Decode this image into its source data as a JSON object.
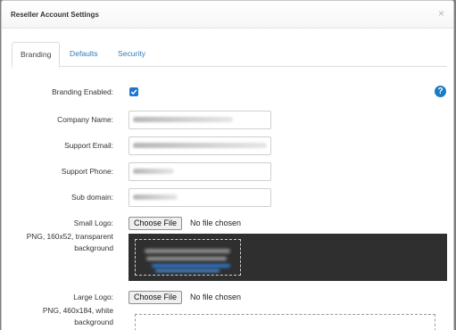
{
  "modal": {
    "title": "Reseller Account Settings",
    "close_glyph": "×"
  },
  "tabs": [
    {
      "label": "Branding",
      "active": true
    },
    {
      "label": "Defaults",
      "active": false
    },
    {
      "label": "Security",
      "active": false
    }
  ],
  "help_icon": {
    "glyph": "?",
    "color": "#1a7bc4"
  },
  "form": {
    "branding_enabled": {
      "label": "Branding Enabled:",
      "checked": true
    },
    "company_name": {
      "label": "Company Name:"
    },
    "support_email": {
      "label": "Support Email:"
    },
    "support_phone": {
      "label": "Support Phone:"
    },
    "sub_domain": {
      "label": "Sub domain:"
    },
    "small_logo": {
      "label": "Small Logo:",
      "hint": "PNG, 160x52, transparent background",
      "button": "Choose File",
      "status": "No file chosen"
    },
    "large_logo": {
      "label": "Large Logo:",
      "hint": "PNG, 460x184, white background",
      "button": "Choose File",
      "status": "No file chosen"
    }
  },
  "colors": {
    "accent": "#1976d2",
    "link": "#337ab7",
    "logo_preview_bg": "#2f2f2f"
  }
}
